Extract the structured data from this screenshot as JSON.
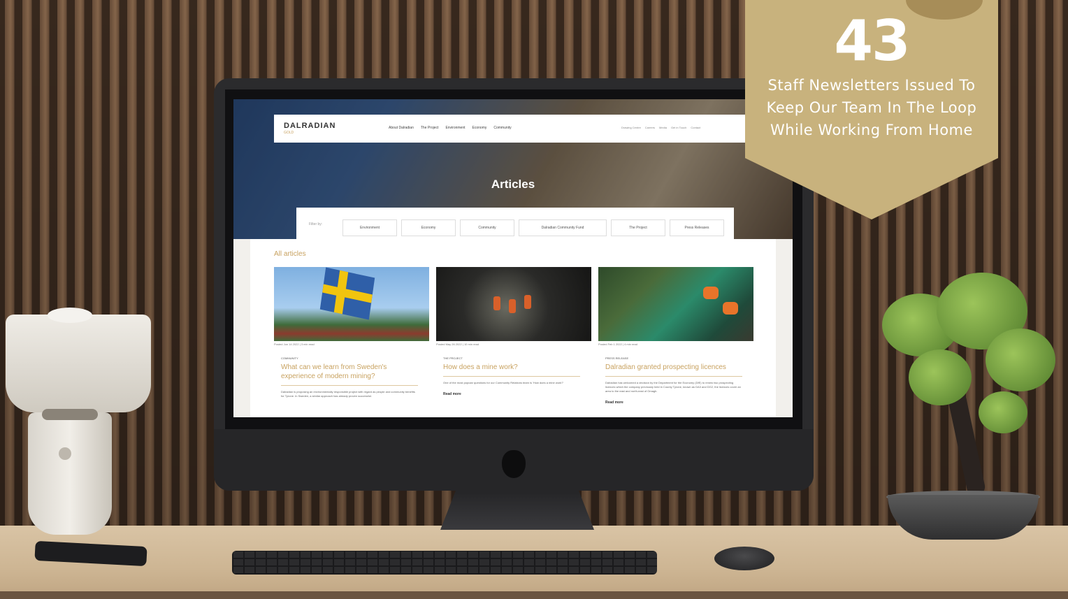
{
  "badge": {
    "number": "43",
    "text": "Staff Newsletters Issued To Keep Our Team In The Loop While Working From Home"
  },
  "website": {
    "logo": "DALRADIAN",
    "logo_sub": "GOLD",
    "nav_links": [
      "About Dalradian",
      "The Project",
      "Environment",
      "Economy",
      "Community"
    ],
    "nav_right": [
      "Drawing Centre",
      "Careers",
      "Media",
      "Get in Touch",
      "Contact"
    ],
    "hero_title": "Articles",
    "filter_label": "Filter by:",
    "filters": [
      "Environment",
      "Economy",
      "Community",
      "Dalradian Community Fund",
      "The Project",
      "Press Releases"
    ],
    "section_title": "All articles",
    "articles": [
      {
        "meta": "Posted Jun 14 2022 | 3 min read",
        "category": "COMMUNITY",
        "title": "What can we learn from Sweden's experience of modern mining?",
        "excerpt": "Dalradian is proposing an environmentally responsible project with regard as people and community benefits for Tyrone. In Sweden, a similar approach has already proven successful.",
        "more": ""
      },
      {
        "meta": "Posted May 26 2022 | 10 min read",
        "category": "THE PROJECT",
        "title": "How does a mine work?",
        "excerpt": "One of the most popular questions for our Community Relations team is 'How does a mine work?'",
        "more": "Read more"
      },
      {
        "meta": "Posted Feb 1 2022 | 4 min read",
        "category": "PRESS RELEASE",
        "title": "Dalradian granted prospecting licences",
        "excerpt": "Dalradian has welcomed a decision by the Department for the Economy (DfE) to renew two prospecting licences which the company previously held in County Tyrone, known as DA3 and DG2, the licences cover an area to the east and north-east of Omagh.",
        "more": "Read more"
      }
    ]
  }
}
